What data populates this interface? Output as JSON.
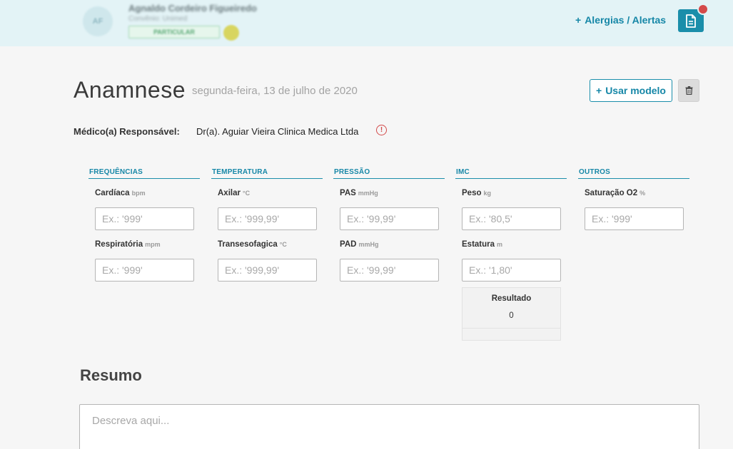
{
  "header": {
    "avatar_initials": "AF",
    "patient_name": "Agnaldo Cordeiro Figueiredo",
    "patient_sub": "Convênio: Unimed",
    "patient_tag": "PARTICULAR",
    "alerts_label": "Alergias / Alertas",
    "icons": {
      "add": "plus-icon",
      "document": "document-icon",
      "notification": "notification-dot"
    },
    "colors": {
      "accent": "#1a8eaa",
      "header_bg": "#e3f3f6",
      "alert": "#d44a4a"
    }
  },
  "page": {
    "title": "Anamnese",
    "date": "segunda-feira, 13 de julho de 2020",
    "use_model_label": "Usar modelo"
  },
  "doctor": {
    "label": "Médico(a) Responsável:",
    "name": "Dr(a). Aguiar Vieira Clinica Medica Ltda"
  },
  "vitals": {
    "frequencias": {
      "header": "FREQUÊNCIAS",
      "cardiaca": {
        "label": "Cardíaca",
        "unit": "bpm",
        "placeholder": "Ex.: '999'"
      },
      "respiratoria": {
        "label": "Respiratória",
        "unit": "mpm",
        "placeholder": "Ex.: '999'"
      }
    },
    "temperatura": {
      "header": "TEMPERATURA",
      "axilar": {
        "label": "Axilar",
        "unit": "°C",
        "placeholder": "Ex.: '999,99'"
      },
      "transesofagica": {
        "label": "Transesofagica",
        "unit": "°C",
        "placeholder": "Ex.: '999,99'"
      }
    },
    "pressao": {
      "header": "PRESSÃO",
      "pas": {
        "label": "PAS",
        "unit": "mmHg",
        "placeholder": "Ex.: '99,99'"
      },
      "pad": {
        "label": "PAD",
        "unit": "mmHg",
        "placeholder": "Ex.: '99,99'"
      }
    },
    "imc": {
      "header": "IMC",
      "peso": {
        "label": "Peso",
        "unit": "kg",
        "placeholder": "Ex.: '80,5'"
      },
      "estatura": {
        "label": "Estatura",
        "unit": "m",
        "placeholder": "Ex.: '1,80'"
      },
      "resultado_label": "Resultado",
      "resultado_value": "0"
    },
    "outros": {
      "header": "OUTROS",
      "saturacao": {
        "label": "Saturação O2",
        "unit": "%",
        "placeholder": "Ex.: '999'"
      }
    }
  },
  "summary": {
    "title": "Resumo",
    "placeholder": "Descreva aqui..."
  }
}
